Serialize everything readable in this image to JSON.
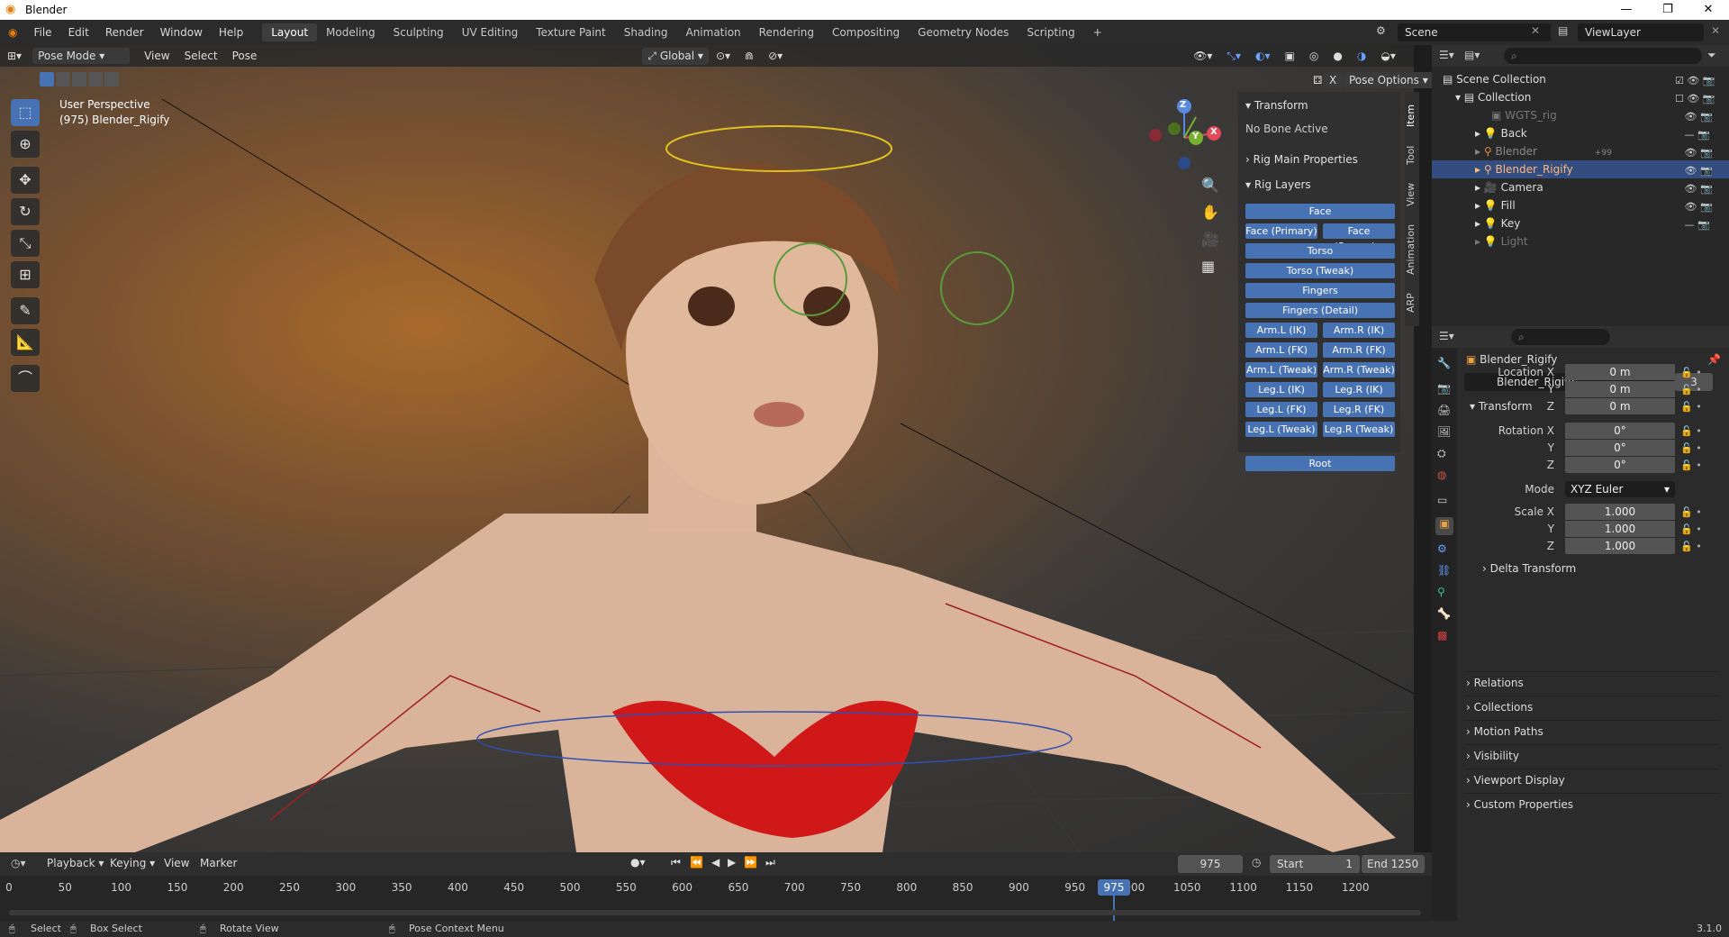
{
  "window": {
    "title": "Blender",
    "controls": [
      "—",
      "❐",
      "✕"
    ]
  },
  "menu": [
    "File",
    "Edit",
    "Render",
    "Window",
    "Help"
  ],
  "workspaces": [
    "Layout",
    "Modeling",
    "Sculpting",
    "UV Editing",
    "Texture Paint",
    "Shading",
    "Animation",
    "Rendering",
    "Compositing",
    "Geometry Nodes",
    "Scripting",
    "+"
  ],
  "active_workspace": "Layout",
  "scene": "Scene",
  "view_layer": "ViewLayer",
  "viewport": {
    "mode": "Pose Mode",
    "menus": [
      "View",
      "Select",
      "Pose"
    ],
    "orientation": "Global",
    "pose_options": "Pose Options",
    "overlay_title": "User Perspective",
    "overlay_object": "(975) Blender_Rigify",
    "gizmo_axes": {
      "z": "Z",
      "y": "Y",
      "x": "X"
    }
  },
  "npanel": {
    "tabs": [
      "Item",
      "Tool",
      "View",
      "Animation",
      "ARP"
    ],
    "transform_title": "Transform",
    "no_bone": "No Bone Active",
    "rig_main": "Rig Main Properties",
    "rig_layers": "Rig Layers",
    "buttons_full": [
      "Face",
      "Torso",
      "Torso (Tweak)",
      "Fingers",
      "Fingers (Detail)"
    ],
    "buttons_pairs": [
      [
        "Face (Primary)",
        "Face (Second..."
      ],
      [
        "Arm.L (IK)",
        "Arm.R (IK)"
      ],
      [
        "Arm.L (FK)",
        "Arm.R (FK)"
      ],
      [
        "Arm.L (Tweak)",
        "Arm.R (Tweak)"
      ],
      [
        "Leg.L (IK)",
        "Leg.R (IK)"
      ],
      [
        "Leg.L (FK)",
        "Leg.R (FK)"
      ],
      [
        "Leg.L (Tweak)",
        "Leg.R (Tweak)"
      ]
    ],
    "root": "Root"
  },
  "outliner": {
    "scene_collection": "Scene Collection",
    "collection": "Collection",
    "items": [
      {
        "name": "WGTS_rig",
        "dim": true
      },
      {
        "name": "Back",
        "dim": false
      },
      {
        "name": "Blender",
        "dim": true,
        "badge": "+99"
      },
      {
        "name": "Blender_Rigify",
        "dim": false,
        "selected": true
      },
      {
        "name": "Camera",
        "dim": false
      },
      {
        "name": "Fill",
        "dim": false
      },
      {
        "name": "Key",
        "dim": false
      },
      {
        "name": "Light",
        "dim": true
      }
    ]
  },
  "properties": {
    "object_name": "Blender_Rigify",
    "data_name": "Blender_Rigify",
    "users": "3",
    "transform": "Transform",
    "location_labels": [
      "Location X",
      "Y",
      "Z"
    ],
    "location": [
      "0 m",
      "0 m",
      "0 m"
    ],
    "rotation_labels": [
      "Rotation X",
      "Y",
      "Z"
    ],
    "rotation": [
      "0°",
      "0°",
      "0°"
    ],
    "mode_label": "Mode",
    "mode": "XYZ Euler",
    "scale_labels": [
      "Scale X",
      "Y",
      "Z"
    ],
    "scale": [
      "1.000",
      "1.000",
      "1.000"
    ],
    "delta": "Delta Transform",
    "sections": [
      "Relations",
      "Collections",
      "Motion Paths",
      "Visibility",
      "Viewport Display",
      "Custom Properties"
    ]
  },
  "timeline": {
    "menus": [
      "Playback",
      "Keying",
      "View",
      "Marker"
    ],
    "current_frame": "975",
    "start_label": "Start",
    "start": "1",
    "end_label": "End",
    "end": "1250",
    "ticks": [
      "0",
      "50",
      "100",
      "150",
      "200",
      "250",
      "300",
      "350",
      "400",
      "450",
      "500",
      "550",
      "600",
      "650",
      "700",
      "750",
      "800",
      "850",
      "900",
      "950",
      "975",
      "1000",
      "1050",
      "1100",
      "1150",
      "1200"
    ]
  },
  "statusbar": {
    "items": [
      "Select",
      "Box Select",
      "Rotate View",
      "Pose Context Menu"
    ],
    "version": "3.1.0"
  },
  "colors": {
    "accent": "#4772b3",
    "selected_row": "#334d80",
    "frame_indicator": "#4772b3"
  }
}
